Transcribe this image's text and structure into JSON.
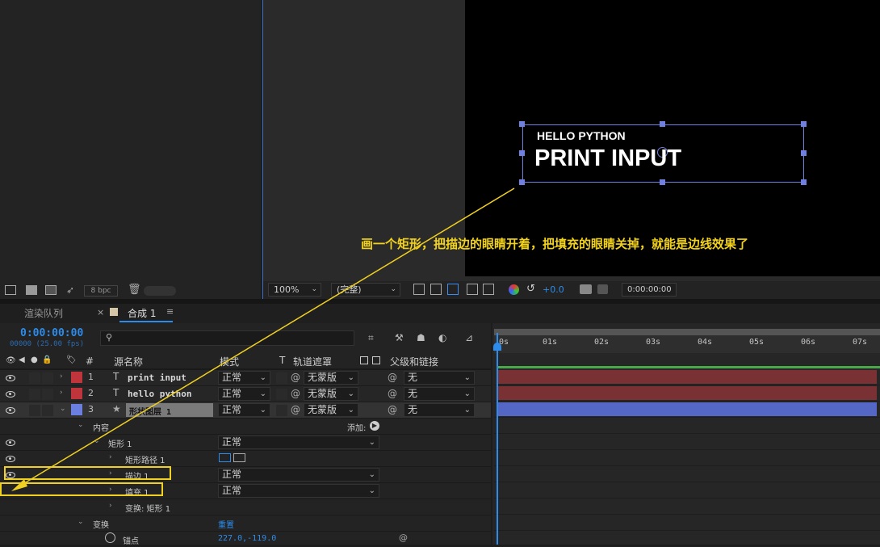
{
  "project": {
    "bpc_label": "8 bpc"
  },
  "composition": {
    "subtitle_text": "HELLO PYTHON",
    "title_text": "PRINT INPUT"
  },
  "annotation": {
    "text": "画一个矩形，把描边的眼睛开着，把填充的眼睛关掉，就能是边线效果了"
  },
  "viewer_bar": {
    "zoom": "100%",
    "resolution": "(完整)",
    "exposure": "+0.0",
    "timecode": "0:00:00:00"
  },
  "tabs": {
    "render_queue": "渲染队列",
    "comp": "合成 1"
  },
  "timeline": {
    "current_time": "0:00:00:00",
    "frame_info": "00000 (25.00 fps)",
    "search_placeholder": "",
    "headers": {
      "num": "#",
      "source_name": "源名称",
      "mode": "模式",
      "t": "T",
      "track_matte": "轨道遮罩",
      "parent": "父级和链接"
    },
    "layers": [
      {
        "num": "1",
        "type_glyph": "T",
        "name": "print input",
        "mode": "正常",
        "matte": "无蒙版",
        "parent": "无",
        "label_color": "#c0353b"
      },
      {
        "num": "2",
        "type_glyph": "T",
        "name": "hello python",
        "mode": "正常",
        "matte": "无蒙版",
        "parent": "无",
        "label_color": "#c0353b"
      },
      {
        "num": "3",
        "type_glyph": "★",
        "name": "形状图层 1",
        "mode": "正常",
        "matte": "无蒙版",
        "parent": "无",
        "label_color": "#6a7fe0"
      }
    ],
    "properties": {
      "contents": "内容",
      "add_label": "添加:",
      "rect": "矩形 1",
      "rect_mode": "正常",
      "rect_path": "矩形路径 1",
      "stroke": "描边 1",
      "stroke_mode": "正常",
      "fill": "填充 1",
      "fill_mode": "正常",
      "transform_rect": "变换: 矩形 1",
      "transform": "变换",
      "reset": "重置",
      "anchor": "锚点",
      "anchor_value": "227.0,-119.0"
    },
    "ruler": [
      "0s",
      "01s",
      "02s",
      "03s",
      "04s",
      "05s",
      "06s",
      "07s"
    ],
    "colors": {
      "text_layer_bar": "#7a3133",
      "shape_layer_bar": "#5567c4",
      "work_area": "#4aa84a",
      "accent": "#2d8ceb",
      "highlight": "#f0d020"
    }
  }
}
